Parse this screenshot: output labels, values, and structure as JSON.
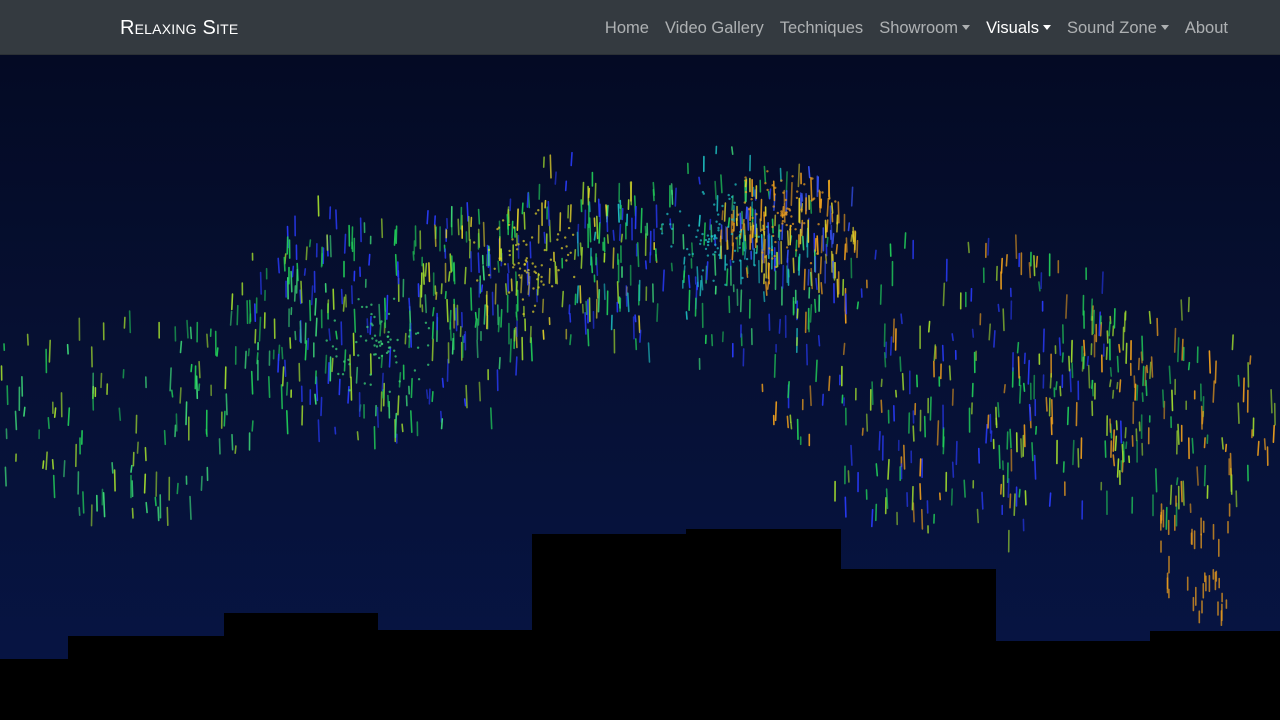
{
  "navbar": {
    "brand": "Relaxing Site",
    "items": [
      {
        "label": "Home",
        "dropdown": false,
        "active": false
      },
      {
        "label": "Video Gallery",
        "dropdown": false,
        "active": false
      },
      {
        "label": "Techniques",
        "dropdown": false,
        "active": false
      },
      {
        "label": "Showroom",
        "dropdown": true,
        "active": false
      },
      {
        "label": "Visuals",
        "dropdown": true,
        "active": true
      },
      {
        "label": "Sound Zone",
        "dropdown": true,
        "active": false
      },
      {
        "label": "About",
        "dropdown": false,
        "active": false
      }
    ]
  },
  "colors": {
    "navbar_bg": "#343a40",
    "nav_text": "rgba(255,255,255,0.6)",
    "nav_text_active": "#ffffff",
    "sky_top": "#040a24",
    "sky_bottom": "#071546",
    "skyline": "#000000"
  },
  "fireworks": {
    "palette": [
      "#22d15a",
      "#3fe07a",
      "#a6e22e",
      "#e5d52a",
      "#f3a21d",
      "#1fc8c8",
      "#2a3cff",
      "#3b57ff"
    ]
  }
}
